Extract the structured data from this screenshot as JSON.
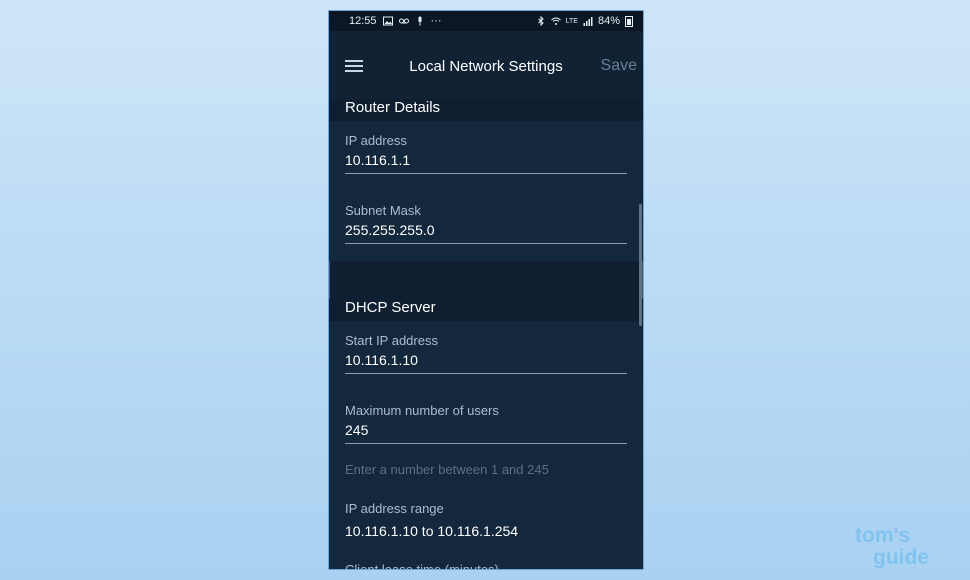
{
  "status_bar": {
    "time": "12:55",
    "battery": "84%",
    "network": "LTE"
  },
  "app_bar": {
    "title": "Local Network Settings",
    "save_label": "Save"
  },
  "router_details": {
    "header": "Router Details",
    "ip_address": {
      "label": "IP address",
      "value": "10.116.1.1"
    },
    "subnet_mask": {
      "label": "Subnet Mask",
      "value": "255.255.255.0"
    }
  },
  "dhcp_server": {
    "header": "DHCP Server",
    "start_ip": {
      "label": "Start IP address",
      "value": "10.116.1.10"
    },
    "max_users": {
      "label": "Maximum number of users",
      "value": "245",
      "helper": "Enter a number between 1 and 245"
    },
    "ip_range": {
      "label": "IP address range",
      "value": "10.116.1.10 to 10.116.1.254"
    },
    "lease_time": {
      "label": "Client lease time (minutes)"
    }
  },
  "watermark": {
    "line1": "tom's",
    "line2": "guide"
  },
  "colors": {
    "page_background": "#bcdcf5",
    "phone_background": "#0f1f31",
    "card_background": "#14283d",
    "watermark": "#7fc4f0"
  }
}
